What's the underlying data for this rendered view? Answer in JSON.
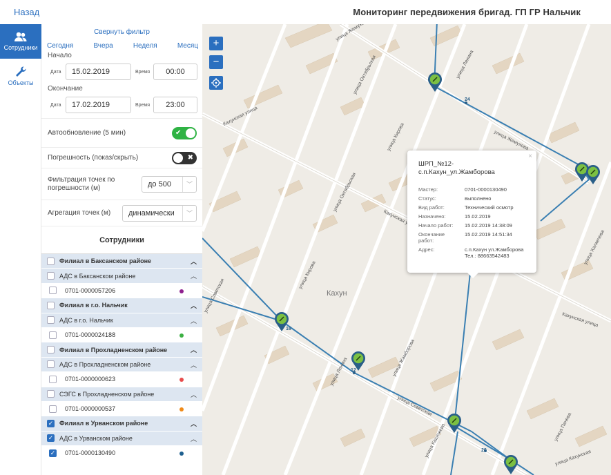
{
  "header": {
    "back_label": "Назад",
    "title": "Мониторинг передвижения бригад. ГП ГР Нальчик"
  },
  "rail": {
    "items": [
      {
        "label": "Сотрудники",
        "icon": "users-icon",
        "active": true
      },
      {
        "label": "Объекты",
        "icon": "wrench-icon",
        "active": false
      }
    ]
  },
  "filter": {
    "collapse_label": "Свернуть фильтр",
    "periods": [
      "Сегодня",
      "Вчера",
      "Неделя",
      "Месяц"
    ],
    "start_label": "Начало",
    "end_label": "Окончание",
    "date_label": "Дата",
    "time_label": "Время",
    "start_date": "15.02.2019",
    "start_time": "00:00",
    "end_date": "17.02.2019",
    "end_time": "23:00",
    "autoupdate_label": "Автообновление (5 мин)",
    "autoupdate_on": true,
    "error_label": "Погрешность (показ/скрыть)",
    "error_on": false,
    "filtering_label": "Фильтрация точек по погрешности (м)",
    "filtering_value": "до 500",
    "aggregation_label": "Агрегация точек (м)",
    "aggregation_value": "динамически"
  },
  "staff": {
    "title": "Сотрудники",
    "rows": [
      {
        "kind": "branch",
        "label": "Филиал в Баксанском районе",
        "checked": false
      },
      {
        "kind": "sub",
        "label": "АДС в Баксанском районе",
        "checked": false
      },
      {
        "kind": "emp",
        "label": "0701-0000057206",
        "checked": false,
        "color": "#8e1f8e"
      },
      {
        "kind": "branch",
        "label": "Филиал в г.о. Нальчик",
        "checked": false
      },
      {
        "kind": "sub",
        "label": "АДС в г.о. Нальчик",
        "checked": false
      },
      {
        "kind": "emp",
        "label": "0701-0000024188",
        "checked": false,
        "color": "#3cb043"
      },
      {
        "kind": "branch",
        "label": "Филиал в Прохладненском районе",
        "checked": false
      },
      {
        "kind": "sub",
        "label": "АДС в Прохладненском районе",
        "checked": false
      },
      {
        "kind": "emp",
        "label": "0701-0000000623",
        "checked": false,
        "color": "#e84c4c"
      },
      {
        "kind": "sub",
        "label": "СЭГС в Прохладненском районе",
        "checked": false
      },
      {
        "kind": "emp",
        "label": "0701-0000000537",
        "checked": false,
        "color": "#f08a18"
      },
      {
        "kind": "branch",
        "label": "Филиал в Урванском районе",
        "checked": true
      },
      {
        "kind": "sub",
        "label": "АДС в Урванском районе",
        "checked": true
      },
      {
        "kind": "emp",
        "label": "0701-0000130490",
        "checked": true,
        "color": "#1e5f8f"
      }
    ]
  },
  "map": {
    "town": "Кахун",
    "streets": [
      "улица Жемухова",
      "улица Октябрьская",
      "улица Ленина",
      "Кахунская улица",
      "улица Кирова",
      "улица Жамборова",
      "улица Халкечева",
      "улица Советская",
      "улица Пачева",
      "улица Кашежева",
      "улица Кахунская",
      "Кахунская улица"
    ],
    "point_labels": [
      "24",
      "16",
      "12",
      "20"
    ],
    "zoom_in": "+",
    "zoom_out": "−",
    "popup": {
      "title": "ШРП_№12-с.п.Кахун_ул.Жамборова",
      "close": "×",
      "fields": [
        {
          "label": "Мастер:",
          "value": "0701-0000130490"
        },
        {
          "label": "Статус:",
          "value": "выполнено"
        },
        {
          "label": "Вид работ:",
          "value": "Технический осмотр"
        },
        {
          "label": "Назначено:",
          "value": "15.02.2019"
        },
        {
          "label": "Начало работ:",
          "value": "15.02.2019 14:38:09"
        },
        {
          "label": "Окончание работ:",
          "value": "15.02.2019 14:51:34"
        },
        {
          "label": "Адрес:",
          "value": "с.п.Кахун ул.Жамборова Тел.: 88663542483"
        }
      ]
    }
  }
}
